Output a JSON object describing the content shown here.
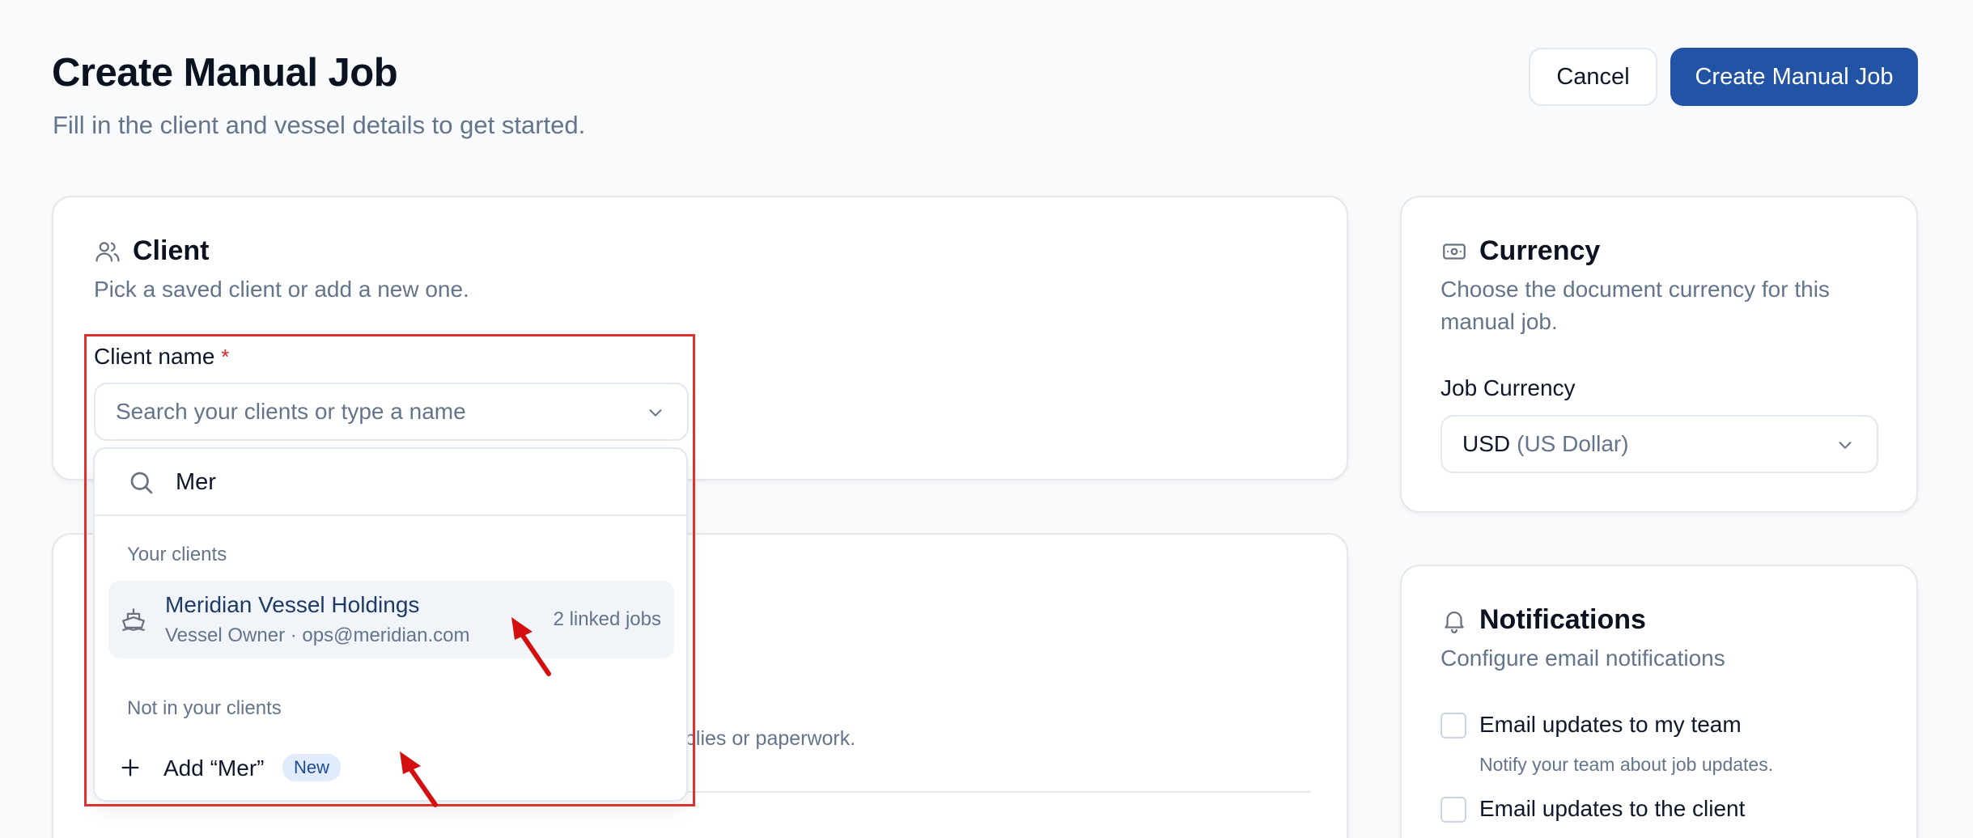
{
  "header": {
    "title": "Create Manual Job",
    "subtitle": "Fill in the client and vessel details to get started.",
    "cancel_label": "Cancel",
    "create_label": "Create Manual Job"
  },
  "client": {
    "title": "Client",
    "description": "Pick a saved client or add a new one.",
    "field_label": "Client name",
    "required_mark": "*",
    "placeholder": "Search your clients or type a name"
  },
  "dropdown": {
    "search_value": "Mer",
    "group_your_clients": "Your clients",
    "result": {
      "name": "Meridian Vessel Holdings",
      "detail": "Vessel Owner · ops@meridian.com",
      "meta": "2 linked jobs"
    },
    "group_not_in_clients": "Not in your clients",
    "add_label": "Add “Mer”",
    "add_badge": "New"
  },
  "second_card": {
    "partial_text": "plies or paperwork."
  },
  "currency": {
    "title": "Currency",
    "description": "Choose the document currency for this manual job.",
    "field_label": "Job Currency",
    "selected_code": "USD",
    "selected_name": "(US Dollar)"
  },
  "notifications": {
    "title": "Notifications",
    "description": "Configure email notifications",
    "options": [
      {
        "label": "Email updates to my team",
        "help": "Notify your team about job updates."
      },
      {
        "label": "Email updates to the client",
        "help": ""
      }
    ]
  },
  "colors": {
    "primary": "#2353a5",
    "highlight": "#e03131",
    "annotation_arrow": "#d40f0f"
  }
}
